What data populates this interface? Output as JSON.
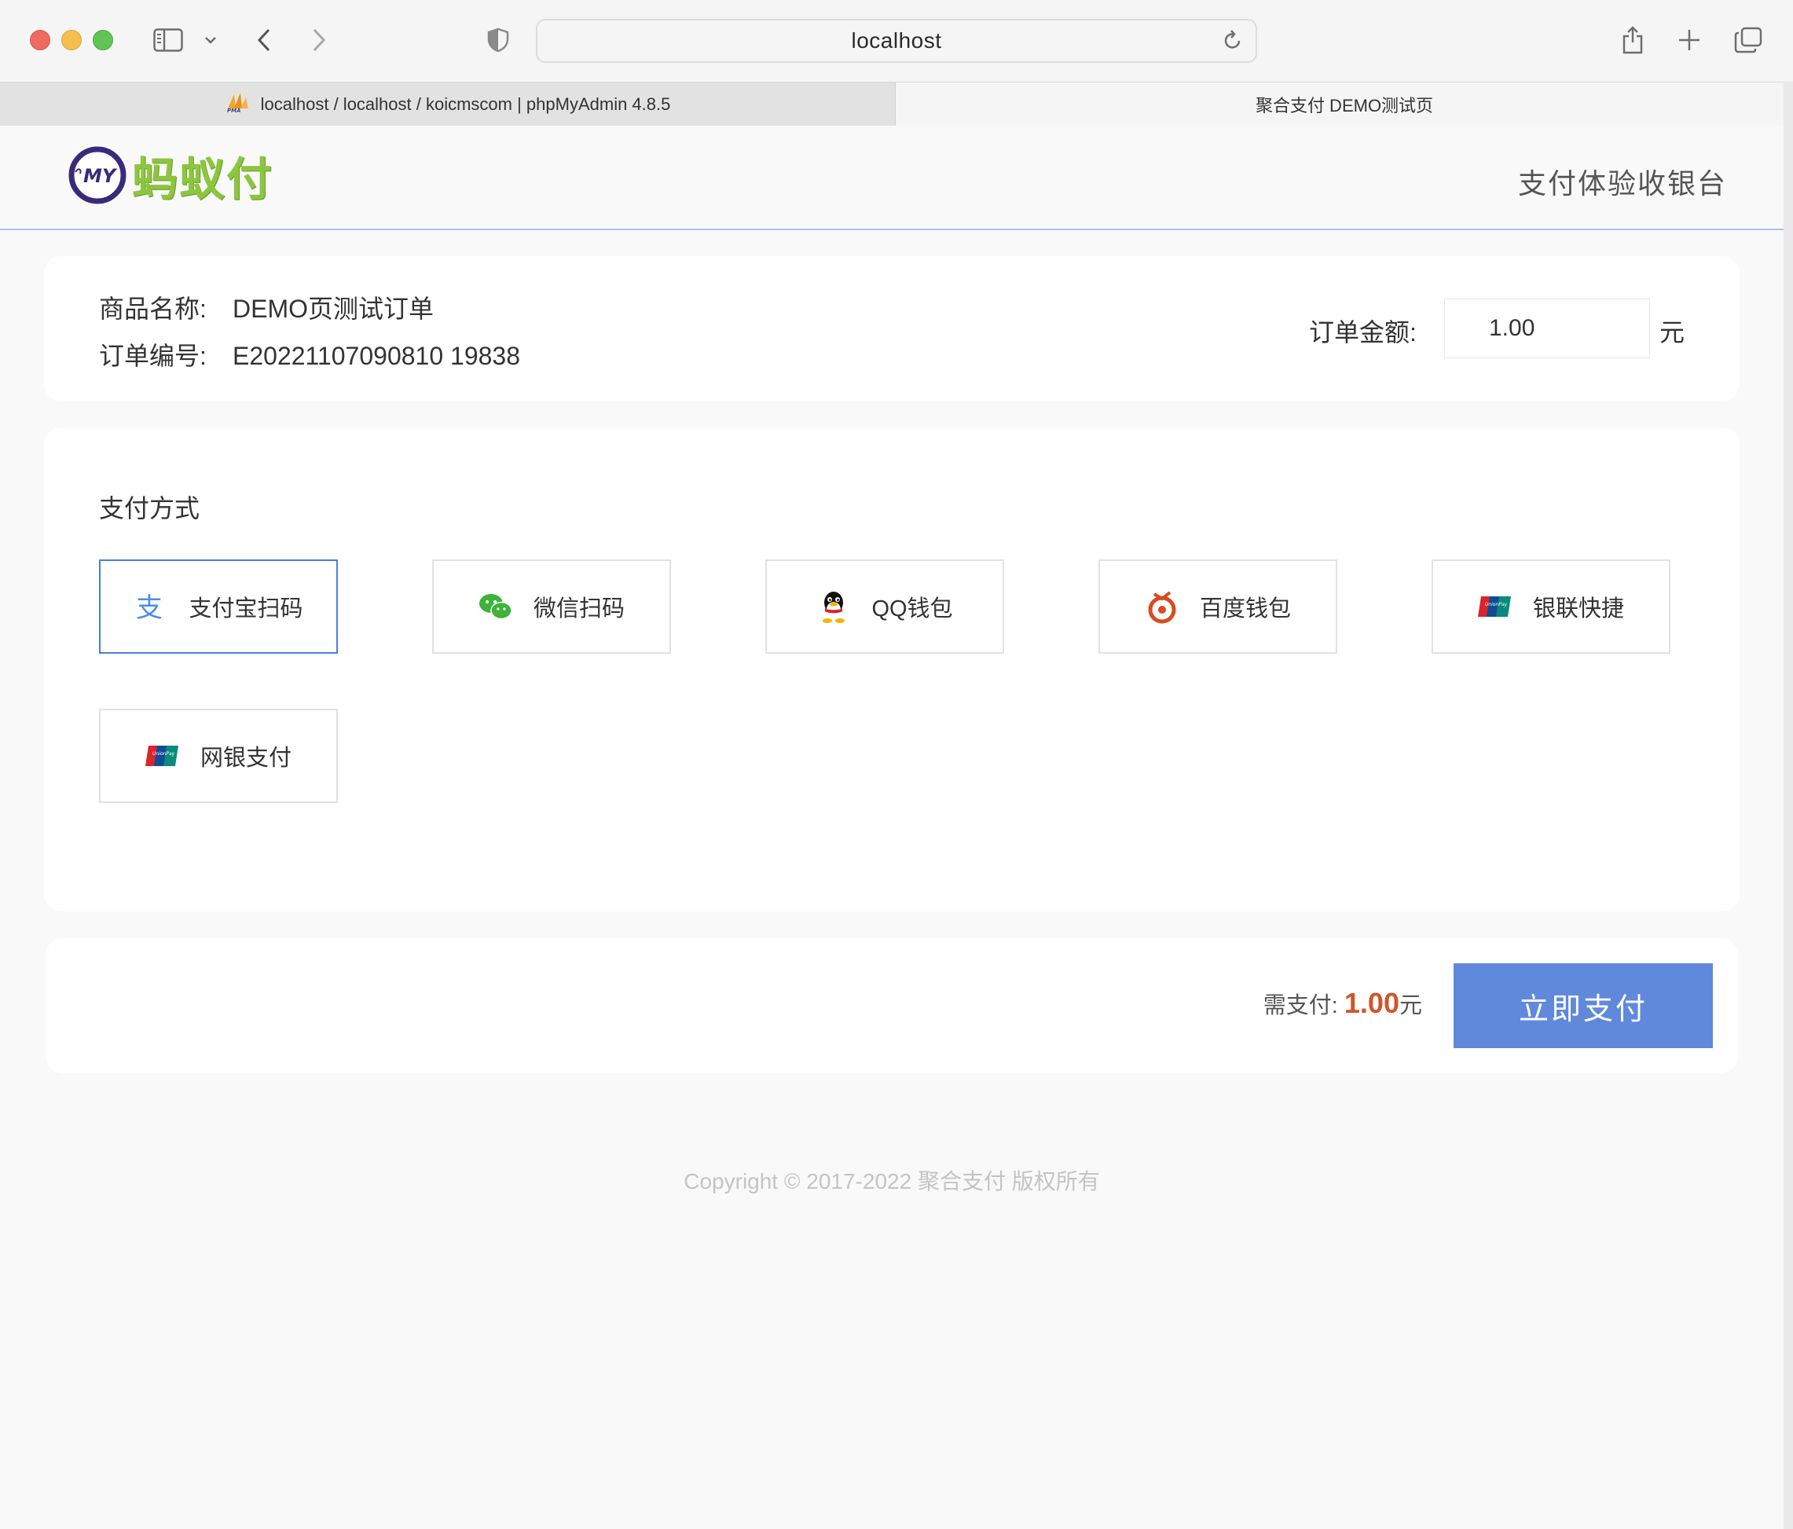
{
  "browser": {
    "url": "localhost",
    "tabs": [
      {
        "label": "localhost / localhost / koicmscom | phpMyAdmin 4.8.5",
        "icon": "phpmyadmin-icon"
      },
      {
        "label": "聚合支付 DEMO测试页"
      }
    ]
  },
  "header": {
    "logo_text": "蚂蚁付",
    "logo_badge": "MY",
    "title": "支付体验收银台"
  },
  "order": {
    "name_label": "商品名称:",
    "name_value": "DEMO页测试订单",
    "number_label": "订单编号:",
    "number_value": "E20221107090810 19838",
    "amount_label": "订单金额:",
    "amount_value": "1.00",
    "currency": "元"
  },
  "payment": {
    "title": "支付方式",
    "methods": [
      {
        "label": "支付宝扫码",
        "icon": "alipay-icon",
        "selected": true
      },
      {
        "label": "微信扫码",
        "icon": "wechat-icon"
      },
      {
        "label": "QQ钱包",
        "icon": "qq-icon"
      },
      {
        "label": "百度钱包",
        "icon": "baidu-wallet-icon"
      },
      {
        "label": "银联快捷",
        "icon": "unionpay-icon"
      },
      {
        "label": "网银支付",
        "icon": "unionpay-icon"
      }
    ]
  },
  "submit": {
    "need_pay_label": "需支付:",
    "need_pay_amount": "1.00",
    "need_pay_unit": "元",
    "button_label": "立即支付"
  },
  "footer": {
    "copyright": "Copyright © 2017-2022 聚合支付 版权所有"
  },
  "colors": {
    "accent": "#6089dc",
    "selected_border": "#4c7ce0",
    "amount": "#d0552a",
    "logo_green": "#8cc63f"
  }
}
